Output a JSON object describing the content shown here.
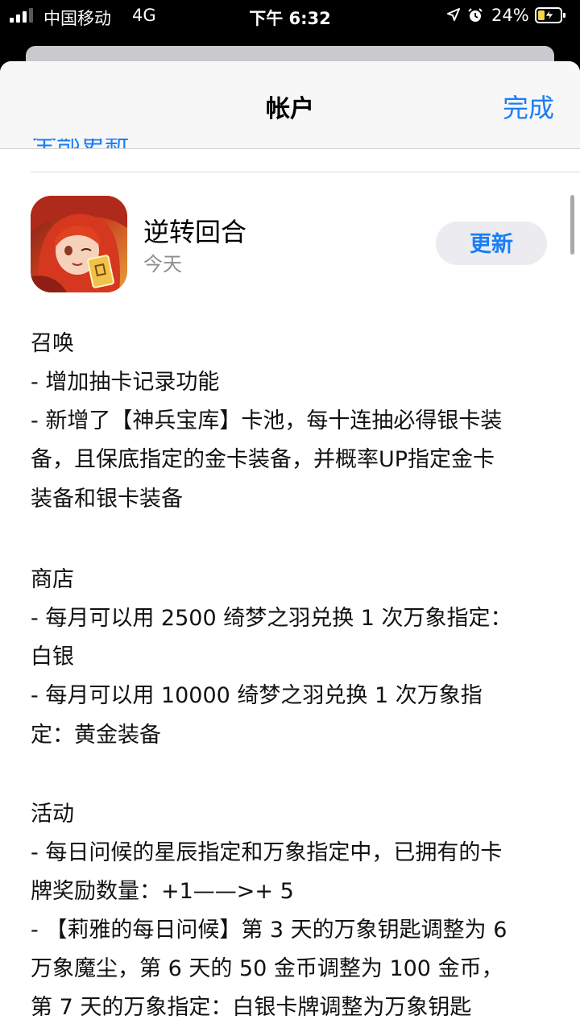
{
  "status_bar": {
    "carrier": "中国移动",
    "network": "4G",
    "time": "下午 6:32",
    "battery": "24%"
  },
  "nav": {
    "title": "帐户",
    "done": "完成",
    "peek": "全部更新"
  },
  "app": {
    "name": "逆转回合",
    "date": "今天",
    "update_label": "更新"
  },
  "notes": [
    "召唤",
    "- 增加抽卡记录功能",
    "- 新增了【神兵宝库】卡池，每十连抽必得银卡装",
    "备，且保底指定的金卡装备，并概率UP指定金卡",
    "装备和银卡装备",
    "",
    " 商店",
    "- 每月可以用 2500 绮梦之羽兑换 1 次万象指定：",
    "白银",
    "- 每月可以用 10000 绮梦之羽兑换 1 次万象指",
    "定：黄金装备",
    "",
    " 活动",
    "- 每日问候的星辰指定和万象指定中，已拥有的卡",
    "牌奖励数量：+1——>+ 5",
    "- 【莉雅的每日问候】第 3 天的万象钥匙调整为 6",
    "万象魔尘，第 6 天的 50 金币调整为 100 金币，",
    "第 7 天的万象指定：白银卡牌调整为万象钥匙"
  ]
}
